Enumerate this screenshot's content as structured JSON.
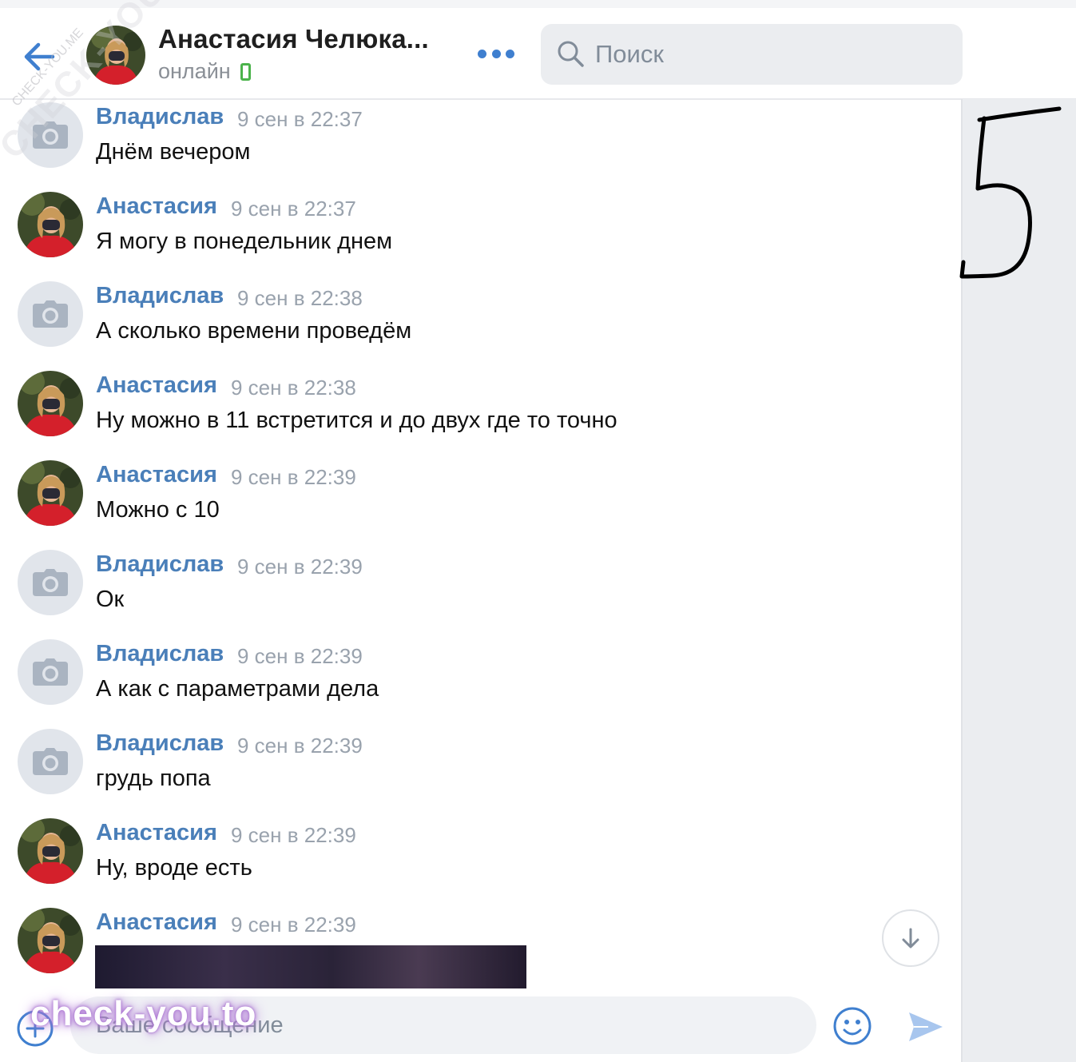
{
  "header": {
    "title": "Анастасия Челюка...",
    "status": "онлайн",
    "search_placeholder": "Поиск"
  },
  "messages": [
    {
      "author": "Владислав",
      "time": "9 сен в 22:37",
      "text": "Днём вечером",
      "avatar": "camera-placeholder"
    },
    {
      "author": "Анастасия",
      "time": "9 сен в 22:37",
      "text": "Я могу в понедельник днем",
      "avatar": "photo"
    },
    {
      "author": "Владислав",
      "time": "9 сен в 22:38",
      "text": "А сколько времени проведём",
      "avatar": "camera-placeholder"
    },
    {
      "author": "Анастасия",
      "time": "9 сен в 22:38",
      "text": "Ну можно в 11 встретится и до двух где то точно",
      "avatar": "photo"
    },
    {
      "author": "Анастасия",
      "time": "9 сен в 22:39",
      "text": "Можно с 10",
      "avatar": "photo"
    },
    {
      "author": "Владислав",
      "time": "9 сен в 22:39",
      "text": "Ок",
      "avatar": "camera-placeholder"
    },
    {
      "author": "Владислав",
      "time": "9 сен в 22:39",
      "text": "А как с параметрами дела",
      "avatar": "camera-placeholder"
    },
    {
      "author": "Владислав",
      "time": "9 сен в 22:39",
      "text": "грудь попа",
      "avatar": "camera-placeholder"
    },
    {
      "author": "Анастасия",
      "time": "9 сен в 22:39",
      "text": "Ну, вроде есть",
      "avatar": "photo"
    },
    {
      "author": "Анастасия",
      "time": "9 сен в 22:39",
      "text": "",
      "avatar": "photo",
      "attachment": "photo"
    }
  ],
  "composer": {
    "placeholder": "Ваше сообщение"
  },
  "annotation": "5",
  "watermarks": {
    "bottom": "check-you.to",
    "diagonal": "CHECK-YOU.ME",
    "small": "CHECK-YOU.ME"
  },
  "colors": {
    "accent": "#4a7fb9",
    "online": "#4bb34b",
    "muted": "#99a2ad"
  }
}
